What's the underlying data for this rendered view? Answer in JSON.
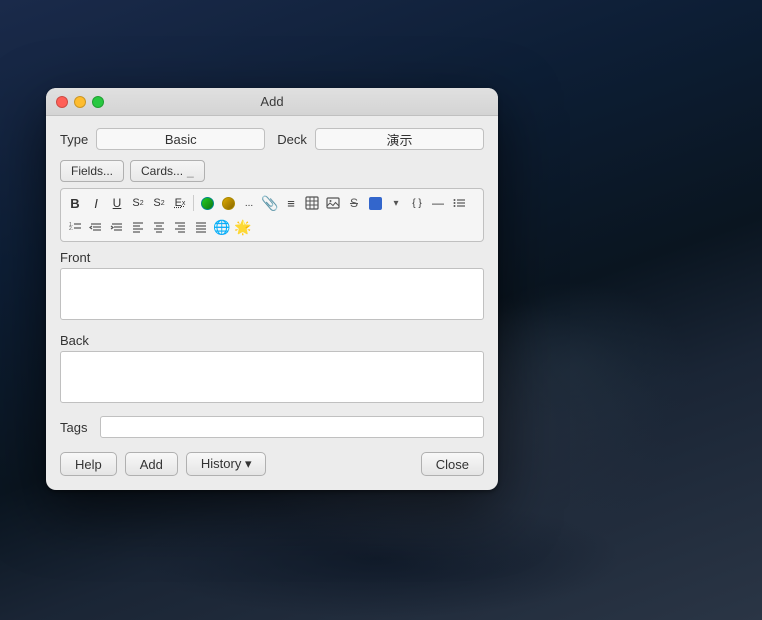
{
  "desktop": {
    "bg_description": "macOS Catalina dark blue rocky landscape"
  },
  "window": {
    "title": "Add",
    "buttons": {
      "close": "close",
      "minimize": "minimize",
      "maximize": "maximize"
    }
  },
  "type_row": {
    "type_label": "Type",
    "type_value": "Basic",
    "deck_label": "Deck",
    "deck_value": "演示"
  },
  "toolbar": {
    "fields_label": "Fields...",
    "cards_label": "Cards...",
    "bold": "B",
    "italic": "I",
    "underline": "U",
    "superscript": "S",
    "subscript": "S",
    "eraser": "Ex",
    "colors": [
      "#22aa22",
      "#d4a017"
    ],
    "more_colors": "...",
    "paperclip": "📎",
    "hamburger": "≡",
    "table_icon": "⊞",
    "image_icon": "🖼",
    "strikethrough": "$",
    "blue_square": "■",
    "chevron": "▾",
    "braces": "{ }",
    "dash": "—",
    "list": "☰",
    "indent_icons": [
      "⊟",
      "⊞",
      "◫",
      "◨",
      "◧",
      "◩"
    ]
  },
  "front": {
    "label": "Front",
    "placeholder": ""
  },
  "back": {
    "label": "Back",
    "placeholder": ""
  },
  "tags": {
    "label": "Tags",
    "value": ""
  },
  "buttons": {
    "help": "Help",
    "add": "Add",
    "history": "History ▾",
    "close": "Close"
  }
}
